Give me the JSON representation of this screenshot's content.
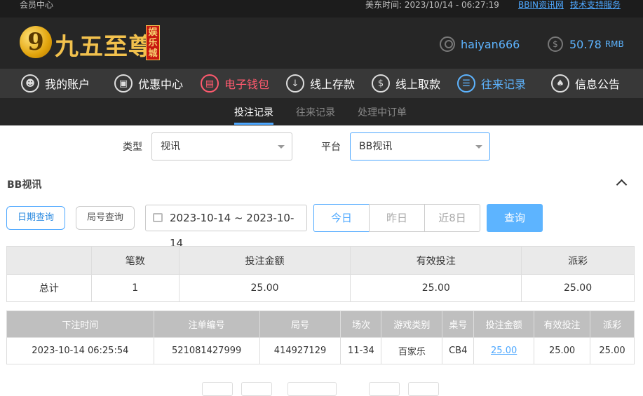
{
  "topbar": {
    "member_center": "会员中心",
    "time_label": "美东时间: 2023/10/14 - 06:27:19",
    "link_info": "BBIN资讯网",
    "link_support": "技术支持服务"
  },
  "header": {
    "logo_digit": "9",
    "logo_text": "九五至尊",
    "logo_seal": "娱乐城",
    "username": "haiyan666",
    "balance": "50.78",
    "balance_unit": "RMB"
  },
  "nav": {
    "items": [
      {
        "label": "我的账户",
        "icon": "user-icon"
      },
      {
        "label": "优惠中心",
        "icon": "gift-icon"
      },
      {
        "label": "电子钱包",
        "icon": "wallet-icon"
      },
      {
        "label": "线上存款",
        "icon": "deposit-icon"
      },
      {
        "label": "线上取款",
        "icon": "withdraw-icon"
      },
      {
        "label": "往来记录",
        "icon": "record-icon"
      },
      {
        "label": "信息公告",
        "icon": "bell-icon"
      }
    ]
  },
  "subnav": {
    "tabs": [
      "投注记录",
      "往来记录",
      "处理中订单"
    ]
  },
  "filters": {
    "type_label": "类型",
    "type_value": "视讯",
    "platform_label": "平台",
    "platform_value": "BB视讯"
  },
  "section": {
    "title": "BB视讯"
  },
  "query": {
    "date_query": "日期查询",
    "round_query": "局号查询",
    "date_range": "2023-10-14 ~ 2023-10-14",
    "today": "今日",
    "yesterday": "昨日",
    "last8": "近8日",
    "submit": "查询"
  },
  "summary": {
    "headers": [
      "",
      "笔数",
      "投注金额",
      "有效投注",
      "派彩"
    ],
    "row": [
      "总计",
      "1",
      "25.00",
      "25.00",
      "25.00"
    ]
  },
  "detail": {
    "headers": [
      "下注时间",
      "注单编号",
      "局号",
      "场次",
      "游戏类别",
      "桌号",
      "投注金额",
      "有效投注",
      "派彩"
    ],
    "rows": [
      [
        "2023-10-14 06:25:54",
        "521081427999",
        "414927129",
        "11-34",
        "百家乐",
        "CB4",
        "25.00",
        "25.00",
        "25.00"
      ]
    ]
  },
  "colors": {
    "accent": "#4ea8ff",
    "active_red": "#ff5a6e",
    "gold": "#f2c14d"
  }
}
